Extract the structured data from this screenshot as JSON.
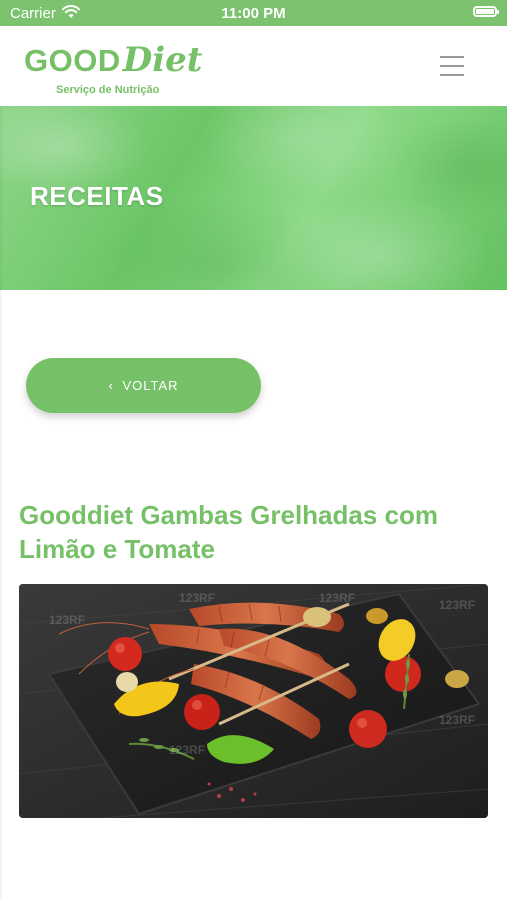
{
  "status_bar": {
    "carrier": "Carrier",
    "time": "11:00 PM"
  },
  "header": {
    "logo_good": "GOOD",
    "logo_diet": "Diet",
    "logo_subtitle": "Serviço de Nutrição"
  },
  "hero": {
    "title": "RECEITAS"
  },
  "back_button": {
    "label": "VOLTAR",
    "icon": "chevron-left-icon"
  },
  "recipe": {
    "title": "Gooddiet Gambas Grelhadas com Limão e Tomate",
    "image_watermark": "123RF"
  },
  "colors": {
    "brand_green": "#76c067",
    "status_bar": "#7dc36f"
  }
}
